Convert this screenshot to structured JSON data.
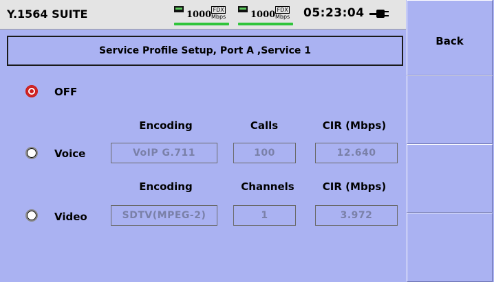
{
  "status_bar": {
    "app_title": "Y.1564 SUITE",
    "links": [
      {
        "speed": "1000",
        "mode_top": "FDX",
        "mode_bottom": "Mbps"
      },
      {
        "speed": "1000",
        "mode_top": "FDX",
        "mode_bottom": "Mbps"
      }
    ],
    "clock": "05:23:04",
    "link_indicator_color": "#2fc43a"
  },
  "header": {
    "title": "Service Profile Setup, Port A ,Service 1"
  },
  "options": {
    "off": {
      "label": "OFF",
      "selected": true
    },
    "voice": {
      "label": "Voice",
      "selected": false,
      "headers": {
        "encoding": "Encoding",
        "calls": "Calls",
        "cir": "CIR (Mbps)"
      },
      "values": {
        "encoding": "VoIP G.711",
        "calls": "100",
        "cir": "12.640"
      }
    },
    "video": {
      "label": "Video",
      "selected": false,
      "headers": {
        "encoding": "Encoding",
        "channels": "Channels",
        "cir": "CIR (Mbps)"
      },
      "values": {
        "encoding": "SDTV(MPEG-2)",
        "channels": "1",
        "cir": "3.972"
      }
    }
  },
  "side_buttons": [
    "Back",
    "",
    "",
    "",
    ""
  ],
  "colors": {
    "background": "#aab2f2",
    "status_bar": "#e4e4e4",
    "selected_radio": "#cc1d1d"
  }
}
